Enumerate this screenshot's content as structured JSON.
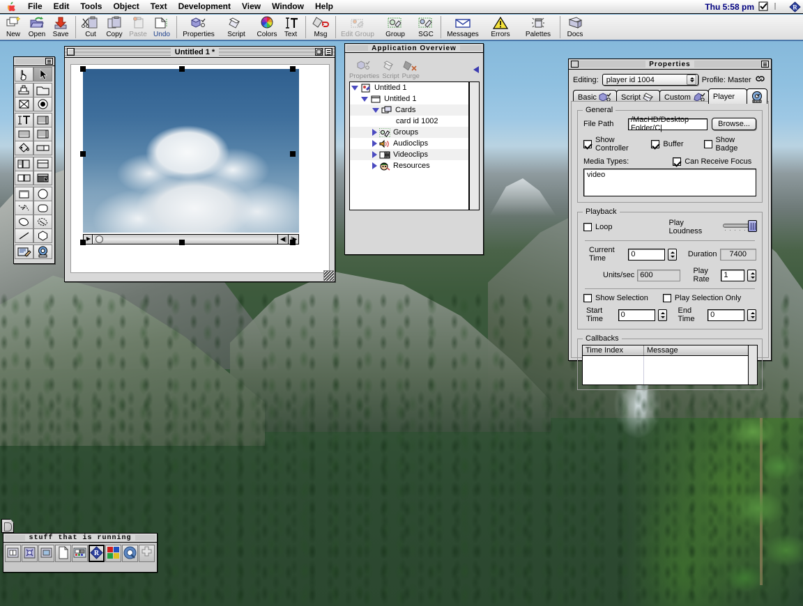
{
  "menubar": {
    "apple_icon": "apple-logo-icon",
    "items": [
      "File",
      "Edit",
      "Tools",
      "Object",
      "Text",
      "Development",
      "View",
      "Window",
      "Help"
    ],
    "clock": "Thu 5:58 pm",
    "right_icons": [
      "checkbox-control-icon",
      "application-switcher-icon"
    ]
  },
  "toolbar": {
    "buttons": [
      {
        "label": "New",
        "icon": "new-document-icon",
        "state": "enabled"
      },
      {
        "label": "Open",
        "icon": "open-folder-icon",
        "state": "enabled"
      },
      {
        "label": "Save",
        "icon": "save-disk-icon",
        "state": "enabled"
      },
      {
        "sep": true
      },
      {
        "label": "Cut",
        "icon": "scissors-icon",
        "state": "enabled"
      },
      {
        "label": "Copy",
        "icon": "copy-icon",
        "state": "enabled"
      },
      {
        "label": "Paste",
        "icon": "paste-icon",
        "state": "disabled"
      },
      {
        "label": "Undo",
        "icon": "undo-icon",
        "state": "link"
      },
      {
        "sep": true
      },
      {
        "label": "Properties",
        "icon": "properties-icon",
        "state": "enabled"
      },
      {
        "label": "Script",
        "icon": "script-icon",
        "state": "enabled"
      },
      {
        "label": "Colors",
        "icon": "colors-wheel-icon",
        "state": "enabled"
      },
      {
        "label": "Text",
        "icon": "text-cursor-icon",
        "state": "enabled"
      },
      {
        "sep": true
      },
      {
        "label": "Msg",
        "icon": "message-icon",
        "state": "enabled"
      },
      {
        "sep": true
      },
      {
        "label": "Edit Group",
        "icon": "edit-group-icon",
        "state": "disabled"
      },
      {
        "label": "Group",
        "icon": "group-icon",
        "state": "enabled"
      },
      {
        "label": "SGC",
        "icon": "sgc-icon",
        "state": "enabled"
      },
      {
        "sep": true
      },
      {
        "label": "Messages",
        "icon": "envelope-icon",
        "state": "enabled"
      },
      {
        "label": "Errors",
        "icon": "warning-triangle-icon",
        "state": "enabled"
      },
      {
        "label": "Palettes",
        "icon": "palettes-icon",
        "state": "enabled"
      },
      {
        "sep": true
      },
      {
        "label": "Docs",
        "icon": "docs-book-icon",
        "state": "enabled"
      }
    ]
  },
  "document_window": {
    "title": "Untitled 1 *",
    "scrubber": {
      "play_icon": "play-triangle-icon",
      "step_back_icon": "step-back-icon",
      "step_forward_icon": "step-forward-icon"
    },
    "stage_content": "cumulus-cloud-photo",
    "selection_handles": 8
  },
  "application_overview": {
    "title": "Application Overview",
    "tools": [
      {
        "label": "Properties",
        "icon": "properties-icon"
      },
      {
        "label": "Script",
        "icon": "script-icon"
      },
      {
        "label": "Purge",
        "icon": "purge-icon"
      }
    ],
    "collapse_icon": "collapse-left-arrow-icon",
    "tree": [
      {
        "label": "Untitled 1",
        "depth": 0,
        "disclosure": "down",
        "icon": "project-icon"
      },
      {
        "label": "Untitled 1",
        "depth": 1,
        "disclosure": "down",
        "icon": "stack-window-icon"
      },
      {
        "label": "Cards",
        "depth": 2,
        "disclosure": "down",
        "icon": "cards-icon"
      },
      {
        "label": "card id 1002",
        "depth": 3,
        "disclosure": "none",
        "icon": "none"
      },
      {
        "label": "Groups",
        "depth": 2,
        "disclosure": "right",
        "icon": "groups-icon"
      },
      {
        "label": "Audioclips",
        "depth": 2,
        "disclosure": "right",
        "icon": "speaker-icon"
      },
      {
        "label": "Videoclips",
        "depth": 2,
        "disclosure": "right",
        "icon": "film-icon"
      },
      {
        "label": "Resources",
        "depth": 2,
        "disclosure": "right",
        "icon": "resources-face-icon"
      }
    ]
  },
  "properties_palette": {
    "title": "Properties",
    "editing_label": "Editing:",
    "editing_value": "player id 1004",
    "profile_label": "Profile: Master",
    "profile_icon": "chain-link-icon",
    "tabs": [
      {
        "label": "Basic",
        "icon": "basic-cube-icon",
        "active": false
      },
      {
        "label": "Script",
        "icon": "script-icon",
        "active": false
      },
      {
        "label": "Custom",
        "icon": "custom-cube-icon",
        "active": false
      },
      {
        "label": "Player",
        "icon": "player-gauge-icon",
        "active": true
      }
    ],
    "general": {
      "group_label": "General",
      "file_path_label": "File Path",
      "file_path_value": "/MacHD/Desktop Folder/C|",
      "browse_button": "Browse...",
      "show_controller": {
        "label": "Show Controller",
        "checked": true
      },
      "buffer": {
        "label": "Buffer",
        "checked": true
      },
      "show_badge": {
        "label": "Show Badge",
        "checked": false
      },
      "can_receive_focus": {
        "label": "Can Receive Focus",
        "checked": true
      },
      "media_types_label": "Media Types:",
      "media_types_value": "video"
    },
    "playback": {
      "group_label": "Playback",
      "loop": {
        "label": "Loop",
        "checked": false
      },
      "play_loudness_label": "Play Loudness",
      "play_loudness_value": 100,
      "current_time_label": "Current Time",
      "current_time_value": "0",
      "duration_label": "Duration",
      "duration_value": "7400",
      "units_per_sec_label": "Units/sec",
      "units_per_sec_value": "600",
      "play_rate_label": "Play Rate",
      "play_rate_value": "1",
      "show_selection": {
        "label": "Show Selection",
        "checked": false
      },
      "play_selection_only": {
        "label": "Play Selection Only",
        "checked": false
      },
      "start_time_label": "Start Time",
      "start_time_value": "0",
      "end_time_label": "End Time",
      "end_time_value": "0"
    },
    "callbacks": {
      "group_label": "Callbacks",
      "columns": [
        "Time Index",
        "Message"
      ],
      "rows": []
    }
  },
  "tool_palette": {
    "tools": [
      {
        "name": "hand-tool",
        "selected": false
      },
      {
        "name": "arrow-pointer-tool",
        "selected": true
      },
      {
        "name": "rubber-stamp-tool",
        "selected": false
      },
      {
        "name": "folder-tool",
        "selected": false
      },
      {
        "name": "crossed-box-tool",
        "selected": false
      },
      {
        "name": "radio-button-tool",
        "selected": false
      },
      {
        "name": "text-field-tool",
        "selected": false
      },
      {
        "name": "list-box-tool",
        "selected": false
      },
      {
        "name": "panel-tool",
        "selected": false
      },
      {
        "name": "scrolling-panel-tool",
        "selected": false
      },
      {
        "name": "paint-bucket-tool",
        "selected": false
      },
      {
        "name": "slider-tool",
        "selected": false
      },
      {
        "name": "tabs-left-tool",
        "selected": false
      },
      {
        "name": "tabs-top-tool",
        "selected": false
      },
      {
        "name": "divider-h-tool",
        "selected": false
      },
      {
        "name": "window-tool",
        "selected": false
      },
      {
        "name": "rectangle-tool",
        "selected": false
      },
      {
        "name": "oval-tool",
        "selected": false
      },
      {
        "name": "polygon-tool",
        "selected": false
      },
      {
        "name": "rounded-rect-tool",
        "selected": false
      },
      {
        "name": "freeform-tool",
        "selected": false
      },
      {
        "name": "lasso-tool",
        "selected": false
      },
      {
        "name": "line-tool",
        "selected": false
      },
      {
        "name": "hexagon-tool",
        "selected": false
      },
      {
        "name": "script-editor-tool",
        "selected": false
      },
      {
        "name": "media-player-tool",
        "selected": false
      }
    ]
  },
  "taskbar": {
    "title": "stuff that is running",
    "apps": [
      {
        "name": "app-finder-icon",
        "active": false
      },
      {
        "name": "app-script-icon",
        "active": false
      },
      {
        "name": "app-monitor-icon",
        "active": false
      },
      {
        "name": "app-document-icon",
        "active": false
      },
      {
        "name": "app-control-panel-icon",
        "active": false
      },
      {
        "name": "app-authoring-tool-icon",
        "active": true
      },
      {
        "name": "app-color-grid-icon",
        "active": false
      },
      {
        "name": "app-quicktime-icon",
        "active": false
      },
      {
        "name": "app-extension-icon",
        "active": false
      }
    ]
  },
  "desktop": {
    "wallpaper": "yosemite-valley-photo",
    "control_strip_icon": "control-strip-tab-icon"
  },
  "colors": {
    "menubar_bg": "#f2f2f2",
    "toolbar_accent": "#4a76a8",
    "window_bg": "#d8d8d8",
    "clock_blue": "#000080",
    "disclosure_blue": "#4a4ac0",
    "slider_thumb": "#8f93d6"
  }
}
